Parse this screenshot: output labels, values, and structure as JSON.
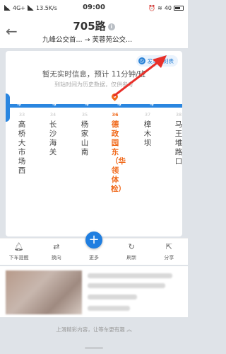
{
  "status_bar": {
    "network": "4G+",
    "speed": "13.5K/s",
    "time": "09:00",
    "battery": "40"
  },
  "header": {
    "back_icon": "back-arrow-icon",
    "route_name": "705路",
    "direction": "九峰公交首... → 芙蓉苑公交..."
  },
  "info": {
    "schedule_label": "发车时刻表",
    "no_realtime": "暂无实时信息，预计 11分钟/班",
    "history_note": "到站时间为历史数据，仅供参考"
  },
  "stops": [
    {
      "no": "33",
      "name": "高桥大市场西"
    },
    {
      "no": "34",
      "name": "长沙海关"
    },
    {
      "no": "35",
      "name": "杨家山南"
    },
    {
      "no": "36",
      "name": "德政园东（华领体检）",
      "current": true
    },
    {
      "no": "37",
      "name": "樟木坝"
    },
    {
      "no": "38",
      "name": "马王堆路口"
    }
  ],
  "toolbar": {
    "remind": "下车提醒",
    "swap": "换向",
    "more": "更多",
    "refresh": "刷新",
    "share": "分享"
  },
  "footer_tip": "上滑精彩内容，让等车更有趣",
  "colors": {
    "accent_blue": "#2a86e0",
    "current_orange": "#f06a1c",
    "annotation_red": "#e8302a"
  }
}
